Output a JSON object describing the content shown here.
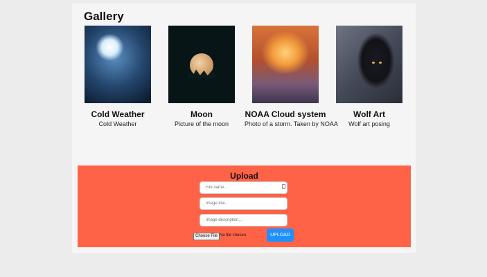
{
  "gallery": {
    "title": "Gallery",
    "items": [
      {
        "title": "Cold Weather",
        "description": "Cold Weather",
        "image": "ice-cave-image"
      },
      {
        "title": "Moon",
        "description": "Picture of the moon",
        "image": "moon-image"
      },
      {
        "title": "NOAA Cloud system",
        "description": "Photo of a storm. Taken by NOAA",
        "image": "storm-cloud-image"
      },
      {
        "title": "Wolf Art",
        "description": "Wolf art posing",
        "image": "wolf-image"
      }
    ]
  },
  "upload": {
    "title": "Upload",
    "file_name_placeholder": "File name...",
    "image_title_placeholder": "Image title...",
    "image_description_placeholder": "Image description...",
    "choose_file_label": "Choose File",
    "no_file_text": "No file chosen",
    "upload_button_label": "UPLOAD",
    "background_color": "#ff6347",
    "button_color": "#1e90ff"
  }
}
